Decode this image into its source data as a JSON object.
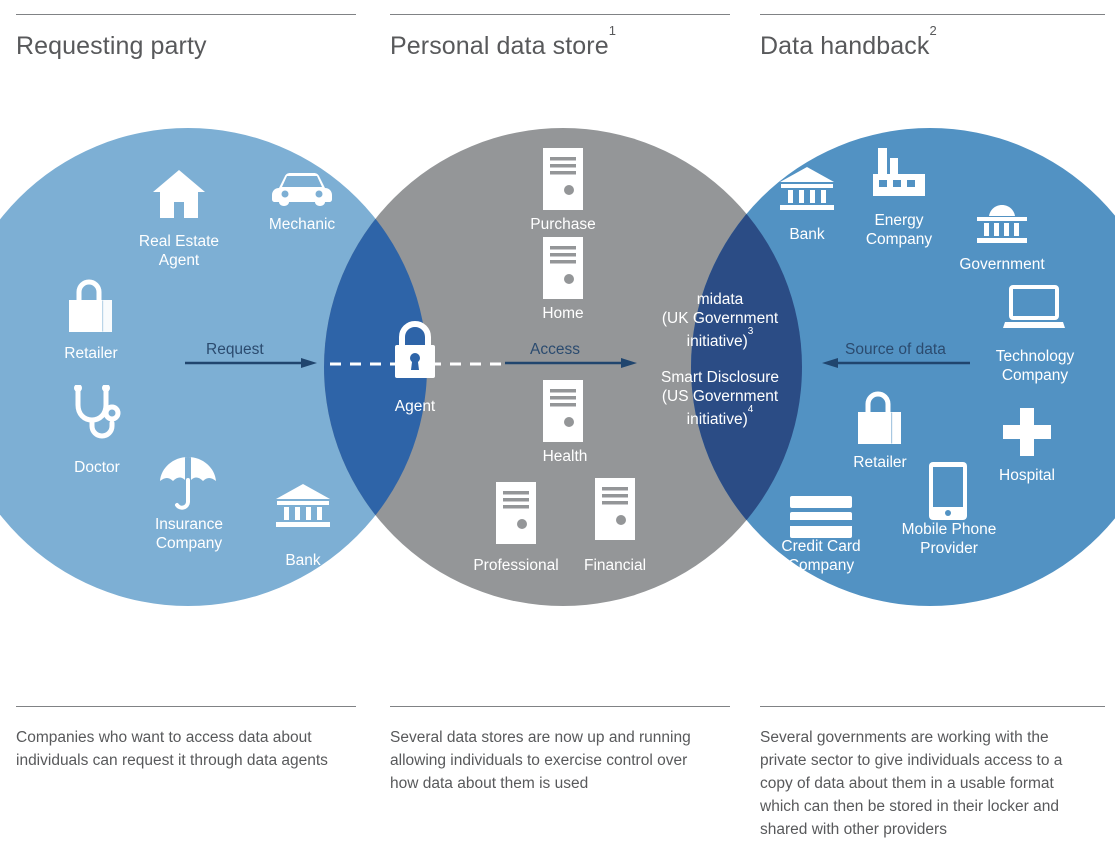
{
  "columns": [
    {
      "title": "Requesting party",
      "sup": "",
      "footer": "Companies who want to access data about individuals can request it through data agents"
    },
    {
      "title": "Personal data store",
      "sup": "1",
      "footer": "Several data stores are now up and running allowing individuals to exercise control over how data about them is used"
    },
    {
      "title": "Data handback",
      "sup": "2",
      "footer": "Several governments are working with the private sector to give individuals access to a copy of data about them in a usable format which can then be stored in their locker and shared with other providers"
    }
  ],
  "colors": {
    "left_circle": "#7DAFD4",
    "center_circle": "#949698",
    "right_circle": "#5292C3",
    "left_overlap": "#2E64A8",
    "right_overlap": "#2B4C85",
    "rule": "#808285",
    "text": "#58595b",
    "arrow": "#20456e"
  },
  "left_circle": {
    "items": [
      {
        "label": "Real Estate\nAgent",
        "icon": "house-icon"
      },
      {
        "label": "Mechanic",
        "icon": "car-icon"
      },
      {
        "label": "Retailer",
        "icon": "shopping-bag-icon"
      },
      {
        "label": "Doctor",
        "icon": "stethoscope-icon"
      },
      {
        "label": "Insurance\nCompany",
        "icon": "umbrella-icon"
      },
      {
        "label": "Bank",
        "icon": "bank-icon"
      }
    ]
  },
  "center_circle": {
    "items": [
      {
        "label": "Purchase",
        "icon": "data-store-icon"
      },
      {
        "label": "Home",
        "icon": "data-store-icon"
      },
      {
        "label": "Health",
        "icon": "data-store-icon"
      },
      {
        "label": "Professional",
        "icon": "data-store-icon"
      },
      {
        "label": "Financial",
        "icon": "data-store-icon"
      }
    ]
  },
  "right_circle": {
    "items": [
      {
        "label": "Bank",
        "icon": "bank-icon"
      },
      {
        "label": "Energy\nCompany",
        "icon": "factory-icon"
      },
      {
        "label": "Government",
        "icon": "government-building-icon"
      },
      {
        "label": "Technology\nCompany",
        "icon": "laptop-icon"
      },
      {
        "label": "Retailer",
        "icon": "shopping-bag-icon"
      },
      {
        "label": "Mobile Phone\nProvider",
        "icon": "mobile-phone-icon"
      },
      {
        "label": "Hospital",
        "icon": "medical-cross-icon"
      },
      {
        "label": "Credit Card\nCompany",
        "icon": "credit-card-icon"
      }
    ]
  },
  "left_overlap": {
    "label": "Agent",
    "icon": "padlock-icon"
  },
  "right_overlap": {
    "line1": "midata",
    "line2": "(UK Government",
    "line3": "initiative)",
    "sup3": "3",
    "line4": "Smart Disclosure",
    "line5": "(US Government",
    "line6": "initiative)",
    "sup4": "4"
  },
  "arrows": [
    {
      "label": "Request",
      "direction": "right"
    },
    {
      "label": "Access",
      "direction": "right"
    },
    {
      "label": "Source of data",
      "direction": "left"
    }
  ]
}
